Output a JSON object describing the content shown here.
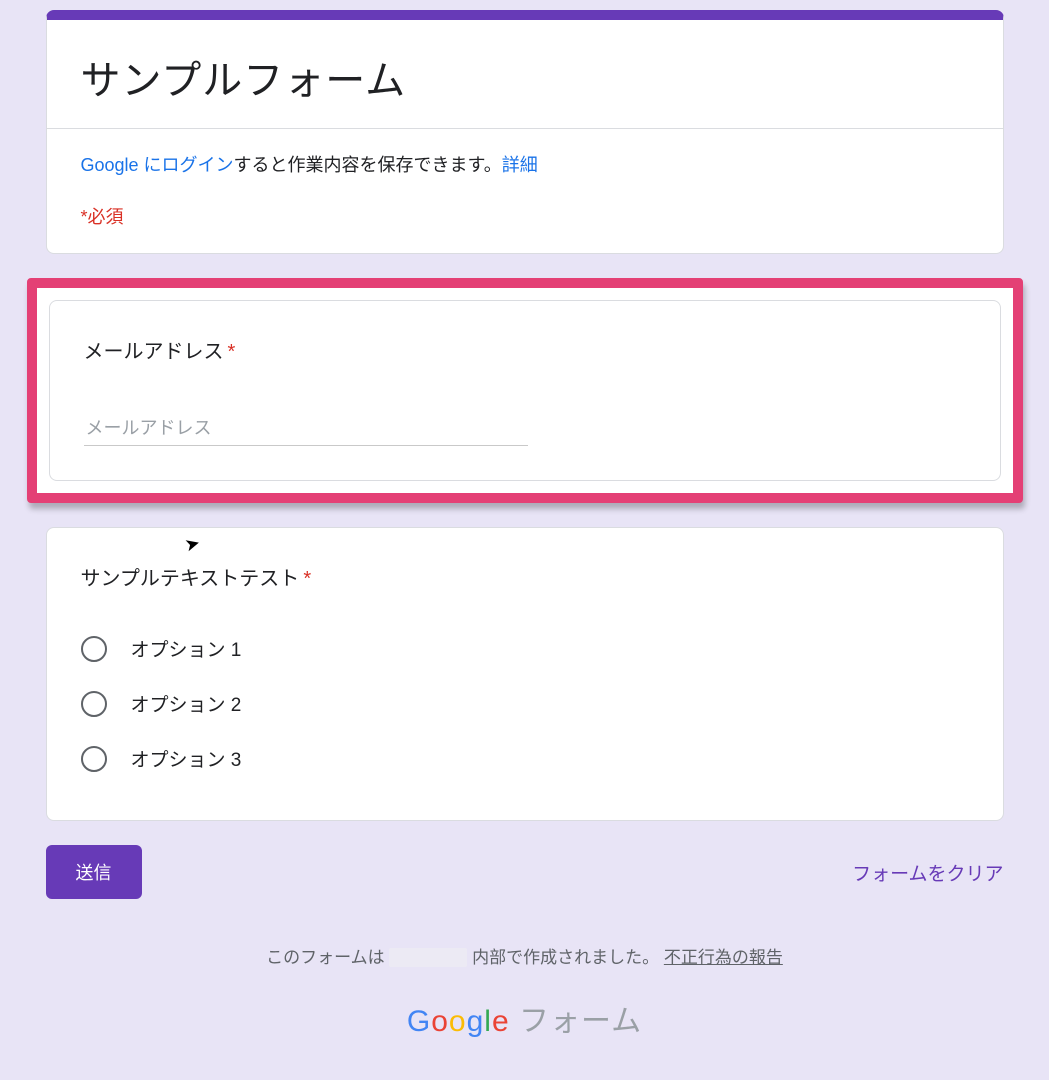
{
  "header": {
    "title": "サンプルフォーム",
    "login_link": "Google にログイン",
    "login_tail": "すると作業内容を保存できます。",
    "detail_link": "詳細",
    "required_note": "*必須"
  },
  "q_email": {
    "title": "メールアドレス",
    "required": true,
    "placeholder": "メールアドレス"
  },
  "q_sample": {
    "title": "サンプルテキストテスト",
    "required": true,
    "options": [
      "オプション 1",
      "オプション 2",
      "オプション 3"
    ]
  },
  "actions": {
    "submit": "送信",
    "clear": "フォームをクリア"
  },
  "footer": {
    "prefix": "このフォームは",
    "suffix": "内部で作成されました。",
    "abuse": "不正行為の報告",
    "logo_tail": " フォーム"
  }
}
